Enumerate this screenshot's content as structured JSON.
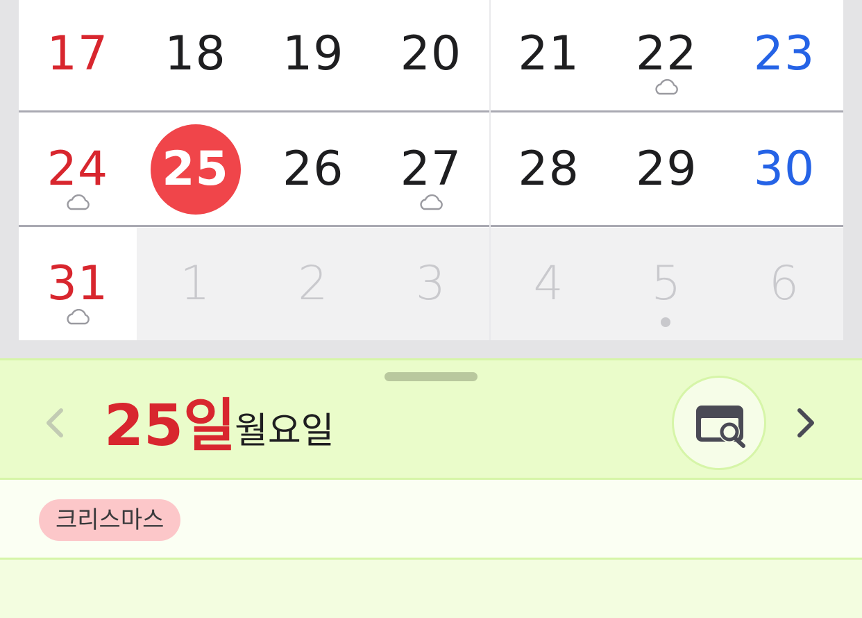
{
  "calendar": {
    "weeks": [
      [
        {
          "day": "17",
          "type": "sun"
        },
        {
          "day": "18",
          "type": "weekday"
        },
        {
          "day": "19",
          "type": "weekday"
        },
        {
          "day": "20",
          "type": "weekday"
        },
        {
          "day": "21",
          "type": "weekday"
        },
        {
          "day": "22",
          "type": "weekday",
          "icon": "cloud-icon"
        },
        {
          "day": "23",
          "type": "sat"
        }
      ],
      [
        {
          "day": "24",
          "type": "sun",
          "icon": "cloud-icon"
        },
        {
          "day": "25",
          "type": "today"
        },
        {
          "day": "26",
          "type": "weekday"
        },
        {
          "day": "27",
          "type": "weekday",
          "icon": "cloud-icon"
        },
        {
          "day": "28",
          "type": "weekday"
        },
        {
          "day": "29",
          "type": "weekday"
        },
        {
          "day": "30",
          "type": "sat"
        }
      ],
      [
        {
          "day": "31",
          "type": "sun",
          "icon": "cloud-icon"
        },
        {
          "day": "1",
          "type": "outside"
        },
        {
          "day": "2",
          "type": "outside"
        },
        {
          "day": "3",
          "type": "outside"
        },
        {
          "day": "4",
          "type": "outside"
        },
        {
          "day": "5",
          "type": "outside",
          "icon": "event-dot"
        },
        {
          "day": "6",
          "type": "outside"
        }
      ]
    ],
    "colors": {
      "sunday": "#d8262e",
      "saturday": "#2563e6",
      "today": "#f0454a",
      "text": "#1e1e20",
      "outside": "#c9c9cd"
    }
  },
  "detail": {
    "day_label": "25일",
    "weekday_label": "월요일",
    "events": [
      {
        "label": "크리스마스",
        "color": "#fcc7c9"
      }
    ]
  }
}
